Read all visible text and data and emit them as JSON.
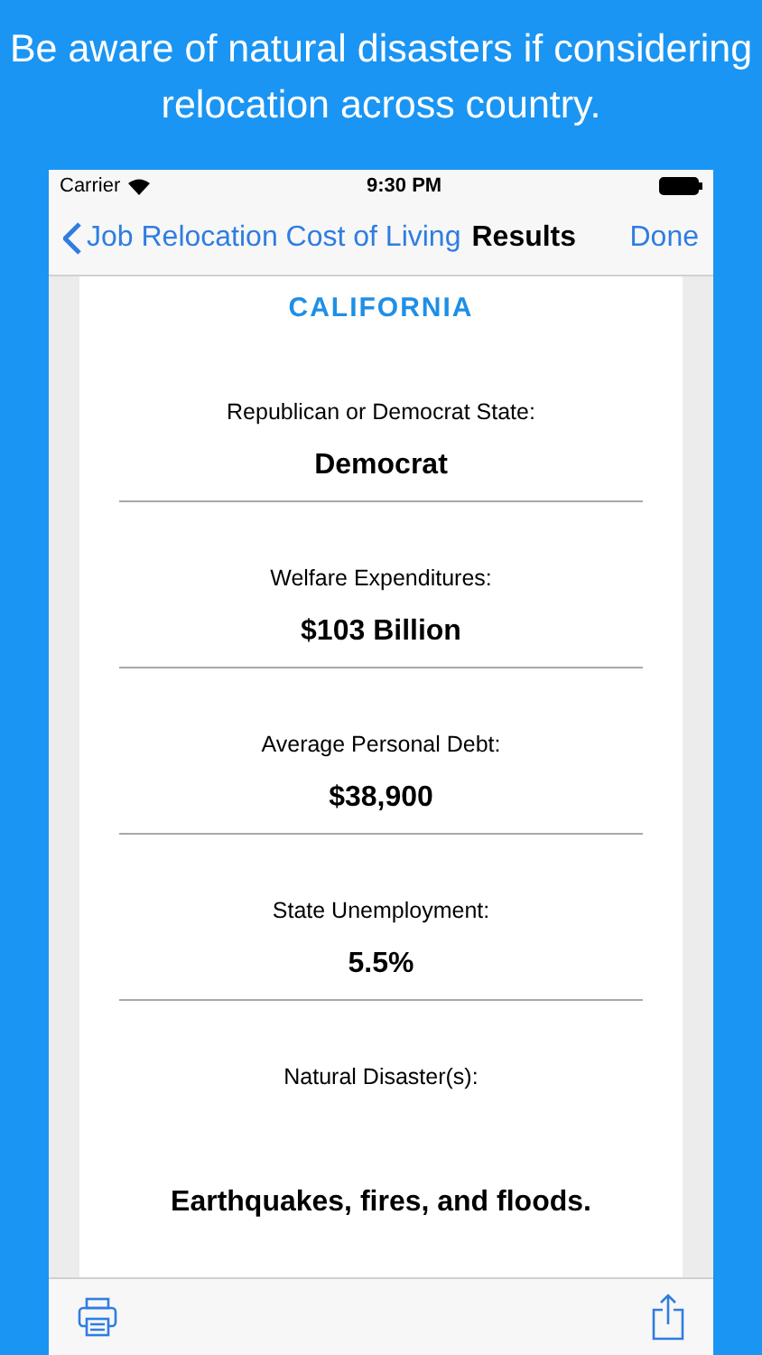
{
  "headline": "Be aware of natural disasters if considering relocation across country.",
  "status_bar": {
    "carrier": "Carrier",
    "time": "9:30 PM"
  },
  "nav": {
    "back": "Job Relocation Cost of Living",
    "title": "Results",
    "done": "Done"
  },
  "state_name": "CALIFORNIA",
  "facts": [
    {
      "label": "Republican or Democrat State:",
      "value": "Democrat"
    },
    {
      "label": "Welfare Expenditures:",
      "value": "$103 Billion"
    },
    {
      "label": "Average Personal Debt:",
      "value": "$38,900"
    },
    {
      "label": "State Unemployment:",
      "value": "5.5%"
    },
    {
      "label": "Natural Disaster(s):",
      "value": "Earthquakes, fires, and floods."
    }
  ]
}
